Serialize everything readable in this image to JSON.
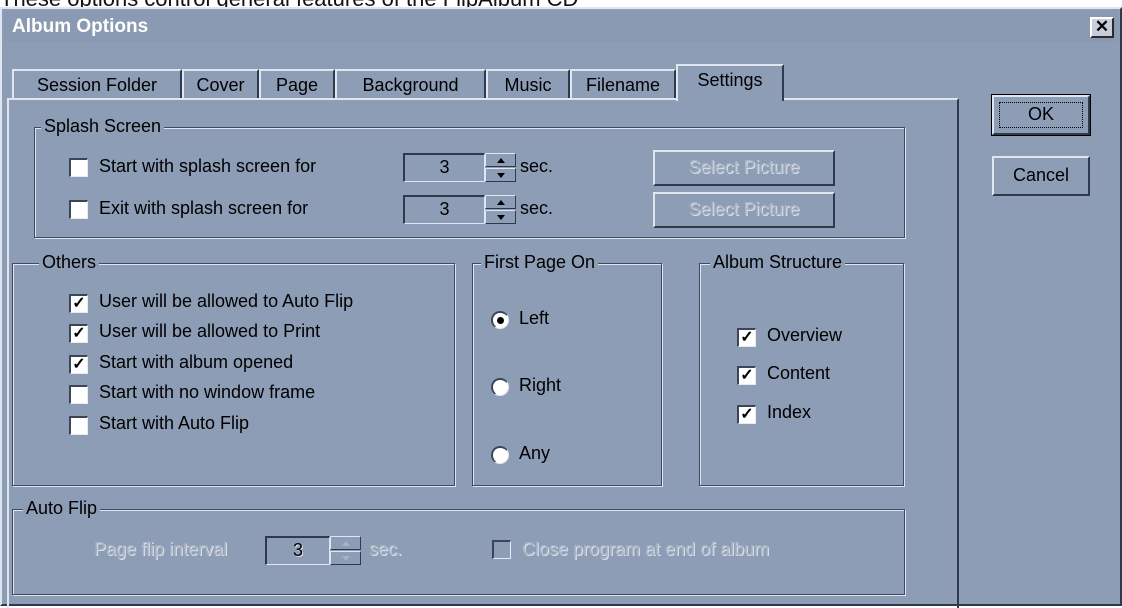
{
  "caption": "These options control general features of the FlipAlbum CD",
  "window": {
    "title": "Album Options",
    "close_glyph": "✕"
  },
  "tabs": [
    {
      "label": "Session Folder"
    },
    {
      "label": "Cover"
    },
    {
      "label": "Page"
    },
    {
      "label": "Background"
    },
    {
      "label": "Music"
    },
    {
      "label": "Filename"
    },
    {
      "label": "Settings",
      "active": true
    }
  ],
  "buttons": {
    "ok": "OK",
    "cancel": "Cancel"
  },
  "splash": {
    "legend": "Splash Screen",
    "start_label": "Start with splash screen for",
    "start_checked": false,
    "start_value": "3",
    "exit_label": "Exit with splash screen for",
    "exit_checked": false,
    "exit_value": "3",
    "unit": "sec.",
    "select_picture": "Select Picture"
  },
  "others": {
    "legend": "Others",
    "items": [
      {
        "label": "User will be allowed to Auto Flip",
        "checked": true
      },
      {
        "label": "User will be allowed to Print",
        "checked": true
      },
      {
        "label": "Start with album opened",
        "checked": true
      },
      {
        "label": "Start with no window frame",
        "checked": false
      },
      {
        "label": "Start with Auto Flip",
        "checked": false
      }
    ]
  },
  "first_page": {
    "legend": "First Page On",
    "options": [
      {
        "label": "Left",
        "selected": true
      },
      {
        "label": "Right",
        "selected": false
      },
      {
        "label": "Any",
        "selected": false
      }
    ]
  },
  "album_structure": {
    "legend": "Album Structure",
    "items": [
      {
        "label": "Overview",
        "checked": true
      },
      {
        "label": "Content",
        "checked": true
      },
      {
        "label": "Index",
        "checked": true
      }
    ]
  },
  "auto_flip": {
    "legend": "Auto Flip",
    "interval_label": "Page flip interval",
    "interval_value": "3",
    "unit": "sec.",
    "close_label": "Close program at end of album",
    "close_checked": false
  },
  "glyphs": {
    "check": "✓"
  }
}
